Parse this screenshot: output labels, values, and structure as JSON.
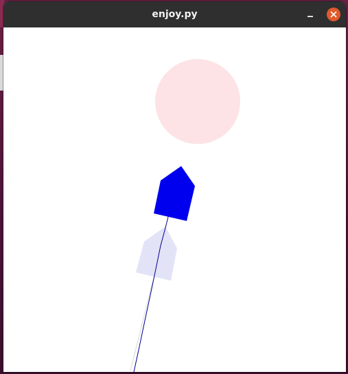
{
  "window": {
    "title": "enjoy.py",
    "controls": {
      "minimize_icon": "minimize-icon",
      "close_icon": "close-icon",
      "close_color": "#e05a2b"
    }
  },
  "scene": {
    "background": "#ffffff",
    "target": {
      "shape": "circle",
      "color": "#fde3e5"
    },
    "agent": {
      "shape": "pentagon",
      "color": "#0000ee"
    },
    "agent_ghost": {
      "shape": "pentagon",
      "color": "#e3e3f8"
    },
    "trajectory": {
      "color": "#00008b"
    },
    "ghost_trajectory": {
      "color": "#d8d8d8"
    }
  }
}
